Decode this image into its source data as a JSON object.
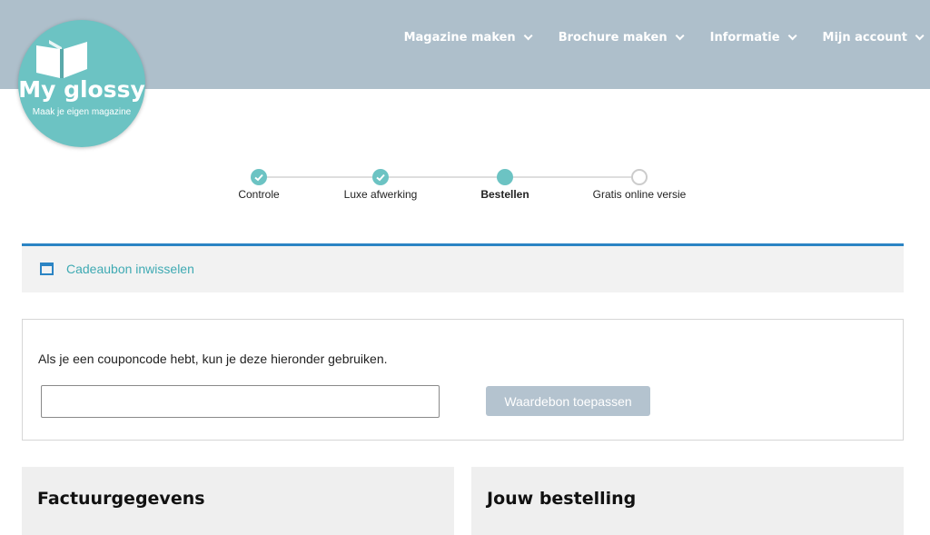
{
  "nav": {
    "items": [
      {
        "label": "Magazine maken"
      },
      {
        "label": "Brochure maken"
      },
      {
        "label": "Informatie"
      },
      {
        "label": "Mijn account"
      }
    ]
  },
  "logo": {
    "brand": "My glossy",
    "tagline": "Maak je eigen magazine"
  },
  "steps": {
    "items": [
      {
        "label": "Controle",
        "state": "done"
      },
      {
        "label": "Luxe afwerking",
        "state": "done"
      },
      {
        "label": "Bestellen",
        "state": "current"
      },
      {
        "label": "Gratis online versie",
        "state": "todo"
      }
    ]
  },
  "voucher": {
    "link_label": "Cadeaubon inwisselen"
  },
  "coupon": {
    "text": "Als je een couponcode hebt, kun je deze hieronder gebruiken.",
    "input_value": "",
    "apply_label": "Waardebon toepassen"
  },
  "panels": {
    "billing_title": "Factuurgegevens",
    "order_title": "Jouw bestelling"
  },
  "colors": {
    "header_bg": "#aebfcb",
    "accent_teal": "#6cc3c3",
    "accent_blue": "#2b84c4",
    "button_disabled": "#b4c3cf"
  }
}
